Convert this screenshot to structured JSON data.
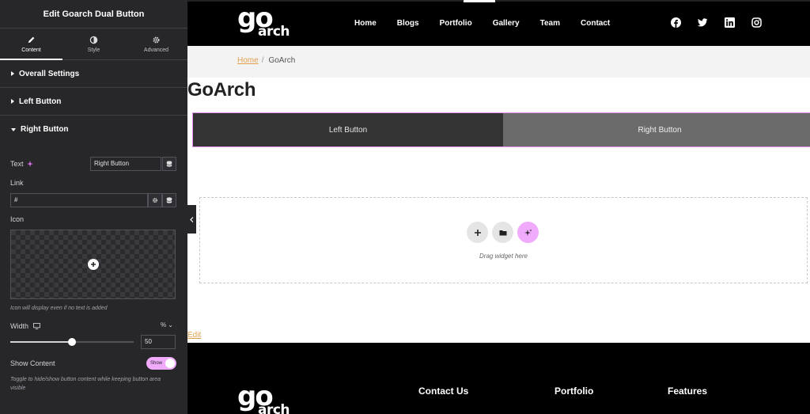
{
  "panel": {
    "title": "Edit Goarch Dual Button",
    "tabs": [
      {
        "label": "Content",
        "icon": "pencil-icon"
      },
      {
        "label": "Style",
        "icon": "half-circle-icon"
      },
      {
        "label": "Advanced",
        "icon": "gear-icon"
      }
    ],
    "sections": [
      {
        "label": "Overall Settings",
        "open": false
      },
      {
        "label": "Left Button",
        "open": false
      },
      {
        "label": "Right Button",
        "open": true
      }
    ],
    "right_button": {
      "text_label": "Text",
      "text_value": "Right Button",
      "link_label": "Link",
      "link_value": "#",
      "icon_label": "Icon",
      "icon_note": "Icon will display even if no text is added",
      "width_label": "Width",
      "width_unit": "%",
      "width_value": "50",
      "width_fraction": 0.5,
      "show_label": "Show Content",
      "show_toggle": "Show",
      "show_note": "Toggle to hide/show button content while keeping button area visible"
    }
  },
  "site": {
    "logo": {
      "go": "go",
      "arch": "arch"
    },
    "nav": [
      "Home",
      "Blogs",
      "Portfolio",
      "Gallery",
      "Team",
      "Contact"
    ],
    "social": [
      "facebook-icon",
      "twitter-icon",
      "linkedin-icon",
      "instagram-icon"
    ],
    "breadcrumb": {
      "home": "Home",
      "separator": "/",
      "current": "GoArch"
    },
    "page_title": "GoArch",
    "dual_button": {
      "left": "Left Button",
      "right": "Right Button"
    },
    "dropzone_text": "Drag widget here",
    "edit_link": "Edit",
    "footer": {
      "headings": [
        "Contact Us",
        "Portfolio",
        "Features"
      ]
    }
  },
  "colors": {
    "panel_bg": "#27272a",
    "accent_pink": "#f0abfc",
    "link_orange": "#e0a050",
    "left_button_bg": "#333333",
    "right_button_bg": "#6b6b6b"
  }
}
